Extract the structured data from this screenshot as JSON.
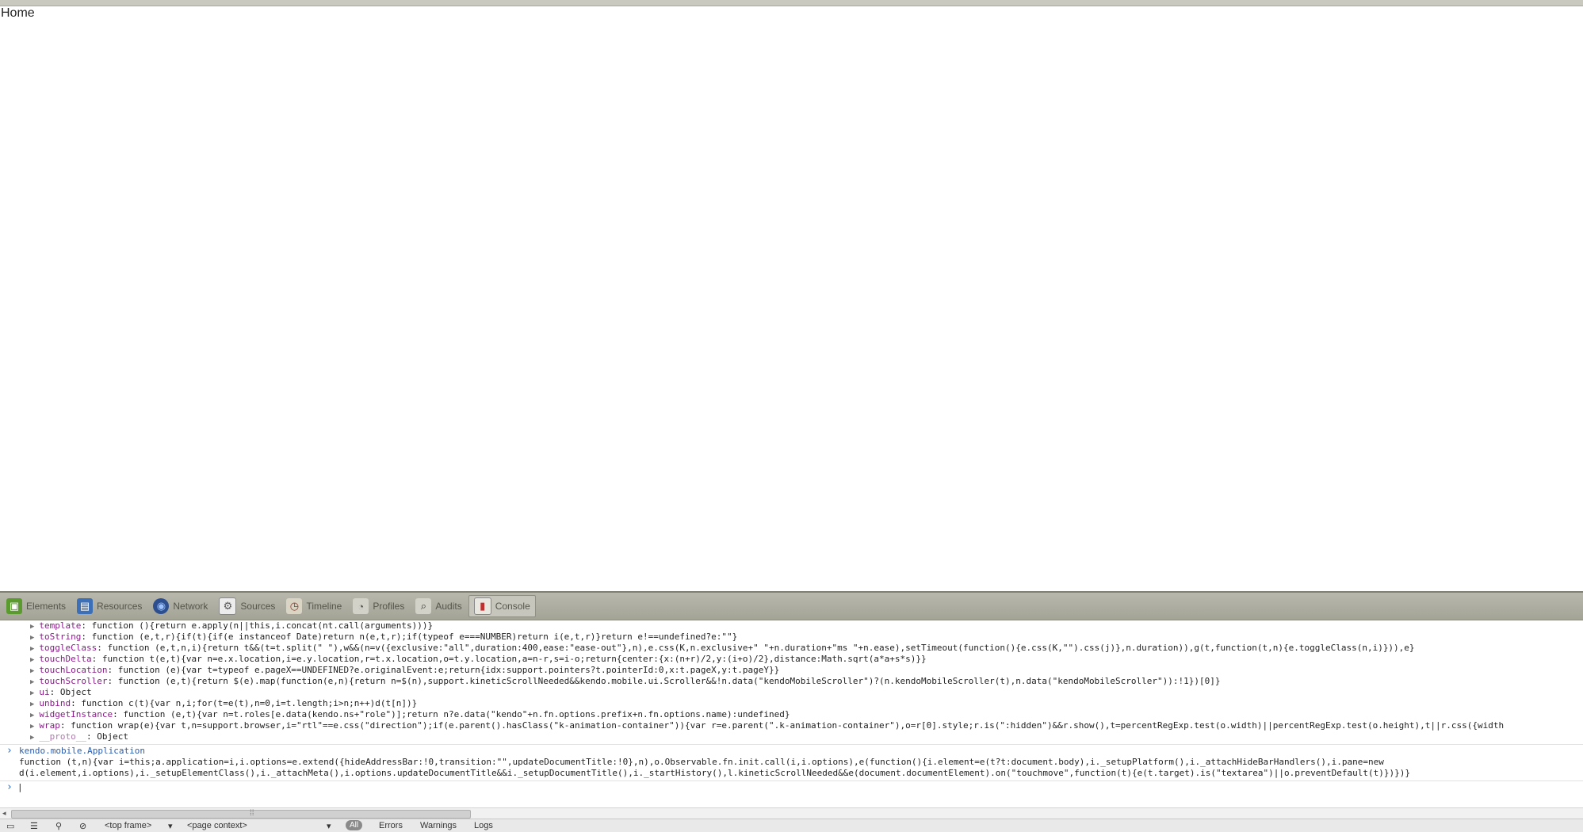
{
  "page": {
    "title": "Home"
  },
  "devtools": {
    "tabs": [
      {
        "label": "Elements",
        "icon": "elements-icon",
        "active": false
      },
      {
        "label": "Resources",
        "icon": "resources-icon",
        "active": false
      },
      {
        "label": "Network",
        "icon": "network-icon",
        "active": false
      },
      {
        "label": "Sources",
        "icon": "sources-icon",
        "active": false
      },
      {
        "label": "Timeline",
        "icon": "timeline-icon",
        "active": false
      },
      {
        "label": "Profiles",
        "icon": "profiles-icon",
        "active": false
      },
      {
        "label": "Audits",
        "icon": "audits-icon",
        "active": false
      },
      {
        "label": "Console",
        "icon": "console-icon",
        "active": true
      }
    ],
    "console_lines": [
      {
        "key": "template",
        "value": "function (){return e.apply(n||this,i.concat(nt.call(arguments)))}"
      },
      {
        "key": "toString",
        "value": "function (e,t,r){if(t){if(e instanceof Date)return n(e,t,r);if(typeof e===NUMBER)return i(e,t,r)}return e!==undefined?e:\"\"}"
      },
      {
        "key": "toggleClass",
        "value": "function (e,t,n,i){return t&&(t=t.split(\" \"),w&&(n=v({exclusive:\"all\",duration:400,ease:\"ease-out\"},n),e.css(K,n.exclusive+\" \"+n.duration+\"ms \"+n.ease),setTimeout(function(){e.css(K,\"\").css(j)},n.duration)),g(t,function(t,n){e.toggleClass(n,i)})),e}"
      },
      {
        "key": "touchDelta",
        "value": "function t(e,t){var n=e.x.location,i=e.y.location,r=t.x.location,o=t.y.location,a=n-r,s=i-o;return{center:{x:(n+r)/2,y:(i+o)/2},distance:Math.sqrt(a*a+s*s)}}"
      },
      {
        "key": "touchLocation",
        "value": "function (e){var t=typeof e.pageX==UNDEFINED?e.originalEvent:e;return{idx:support.pointers?t.pointerId:0,x:t.pageX,y:t.pageY}}"
      },
      {
        "key": "touchScroller",
        "value": "function (e,t){return $(e).map(function(e,n){return n=$(n),support.kineticScrollNeeded&&kendo.mobile.ui.Scroller&&!n.data(\"kendoMobileScroller\")?(n.kendoMobileScroller(t),n.data(\"kendoMobileScroller\")):!1})[0]}"
      },
      {
        "key": "ui",
        "value": "Object"
      },
      {
        "key": "unbind",
        "value": "function c(t){var n,i;for(t=e(t),n=0,i=t.length;i>n;n++)d(t[n])}"
      },
      {
        "key": "widgetInstance",
        "value": "function (e,t){var n=t.roles[e.data(kendo.ns+\"role\")];return n?e.data(\"kendo\"+n.fn.options.prefix+n.fn.options.name):undefined}"
      },
      {
        "key": "wrap",
        "value": "function wrap(e){var t,n=support.browser,i=\"rtl\"==e.css(\"direction\");if(e.parent().hasClass(\"k-animation-container\")){var r=e.parent(\".k-animation-container\"),o=r[0].style;r.is(\":hidden\")&&r.show(),t=percentRegExp.test(o.width)||percentRegExp.test(o.height),t||r.css({width"
      },
      {
        "key": "__proto__",
        "value": "Object"
      }
    ],
    "command": "kendo.mobile.Application",
    "result_line1": "function (t,n){var i=this;a.application=i,i.options=e.extend({hideAddressBar:!0,transition:\"\",updateDocumentTitle:!0},n),o.Observable.fn.init.call(i,i.options),e(function(){i.element=e(t?t:document.body),i._setupPlatform(),i._attachHideBarHandlers(),i.pane=new",
    "result_line2": "d(i.element,i.options),i._setupElementClass(),i._attachMeta(),i.options.updateDocumentTitle&&i._setupDocumentTitle(),i._startHistory(),l.kineticScrollNeeded&&e(document.documentElement).on(\"touchmove\",function(t){e(t.target).is(\"textarea\")||o.preventDefault(t)})})}",
    "status": {
      "frame": "<top frame>",
      "context": "<page context>",
      "filter_all": "All",
      "errors": "Errors",
      "warnings": "Warnings",
      "logs": "Logs"
    }
  }
}
